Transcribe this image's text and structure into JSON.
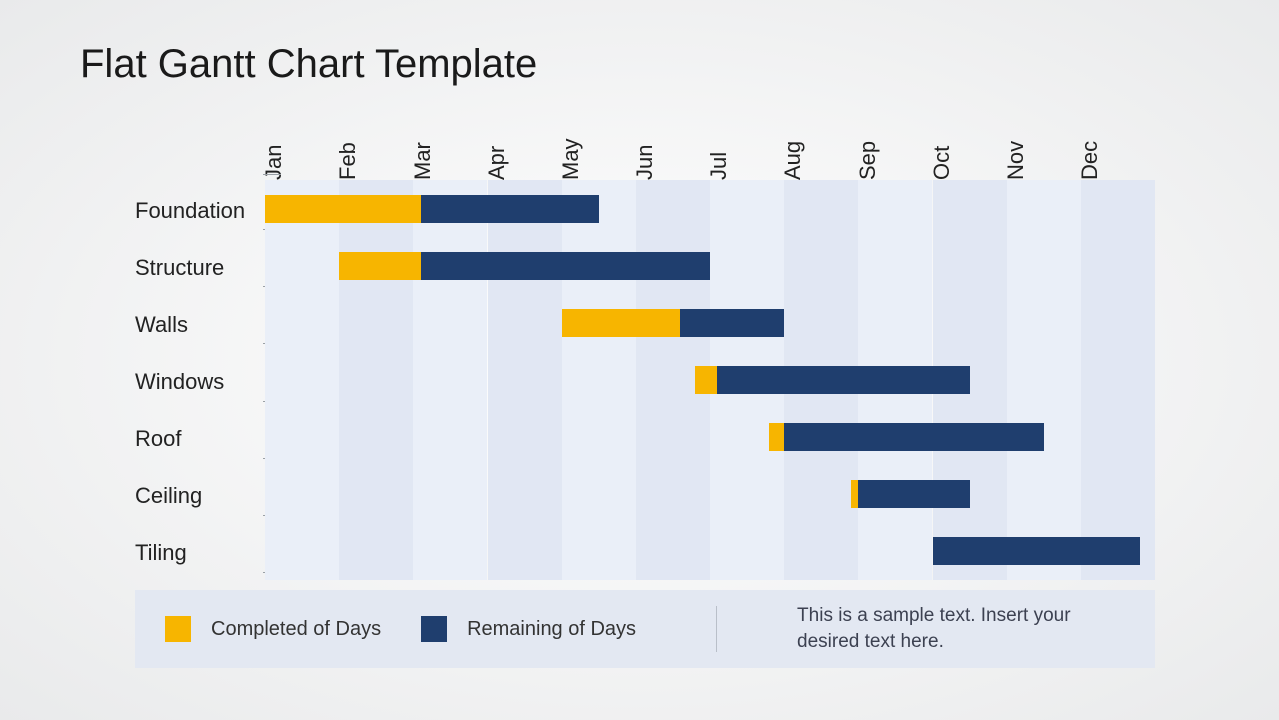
{
  "title": "Flat Gantt Chart Template",
  "chart_data": {
    "type": "bar",
    "categories": [
      "Jan",
      "Feb",
      "Mar",
      "Apr",
      "May",
      "Jun",
      "Jul",
      "Aug",
      "Sep",
      "Oct",
      "Nov",
      "Dec"
    ],
    "tasks": [
      {
        "name": "Foundation",
        "start": 0.0,
        "completed": 2.1,
        "remaining": 2.4
      },
      {
        "name": "Structure",
        "start": 1.0,
        "completed": 1.1,
        "remaining": 3.9
      },
      {
        "name": "Walls",
        "start": 4.0,
        "completed": 1.6,
        "remaining": 1.4
      },
      {
        "name": "Windows",
        "start": 5.8,
        "completed": 0.3,
        "remaining": 3.4
      },
      {
        "name": "Roof",
        "start": 6.8,
        "completed": 0.2,
        "remaining": 3.5
      },
      {
        "name": "Ceiling",
        "start": 7.9,
        "completed": 0.1,
        "remaining": 1.5
      },
      {
        "name": "Tiling",
        "start": 9.0,
        "completed": 0.0,
        "remaining": 2.8
      }
    ],
    "xlabel": "",
    "ylabel": ""
  },
  "legend": {
    "completed": "Completed of Days",
    "remaining": "Remaining of Days",
    "note": "This is a sample text. Insert your desired text here."
  },
  "colors": {
    "completed": "#F7B500",
    "remaining": "#1F3E6E",
    "gridA": "#eaeff8",
    "gridB": "#e1e7f3"
  }
}
